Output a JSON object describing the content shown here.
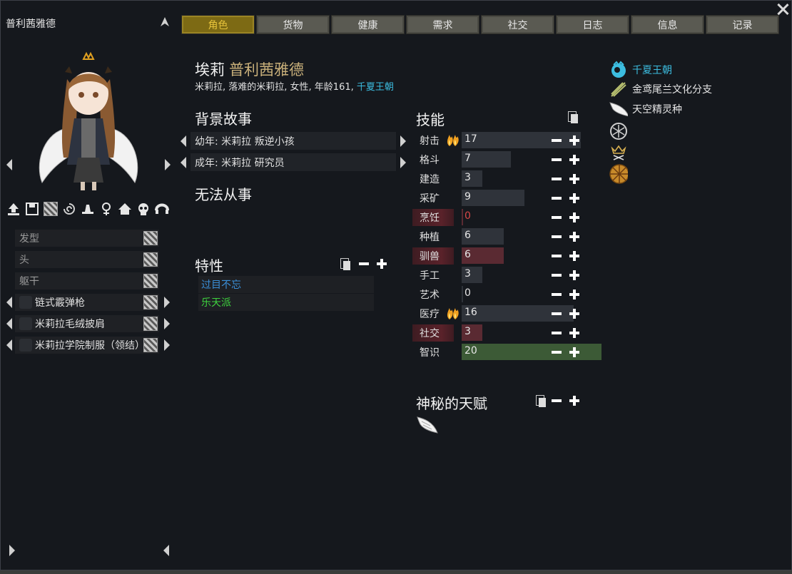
{
  "window": {
    "title": "普利茜雅德",
    "close_icon": "close-icon",
    "pin_icon": "pin-icon"
  },
  "tabs": [
    {
      "label": "角色",
      "active": true
    },
    {
      "label": "货物",
      "active": false
    },
    {
      "label": "健康",
      "active": false
    },
    {
      "label": "需求",
      "active": false
    },
    {
      "label": "社交",
      "active": false
    },
    {
      "label": "日志",
      "active": false
    },
    {
      "label": "信息",
      "active": false
    },
    {
      "label": "记录",
      "active": false
    }
  ],
  "character": {
    "first_name": "埃莉",
    "last_name": "普利茜雅德",
    "description": "米莉拉, 落难的米莉拉, 女性, 年龄161, ",
    "faction": "千夏王朝"
  },
  "toolbar_icons": [
    "export-icon",
    "save-icon",
    "pattern-icon",
    "swirl-icon",
    "hat-icon",
    "female-icon",
    "house-icon",
    "skull-icon",
    "headband-icon"
  ],
  "apparel": [
    {
      "label": "发型",
      "worn": false
    },
    {
      "label": "头",
      "worn": false
    },
    {
      "label": "躯干",
      "worn": false
    },
    {
      "label": "链式霰弹枪",
      "worn": true
    },
    {
      "label": "米莉拉毛绒披肩",
      "worn": true
    },
    {
      "label": "米莉拉学院制服（领结）",
      "worn": true
    }
  ],
  "backstory": {
    "heading": "背景故事",
    "childhood": "幼年: 米莉拉 叛逆小孩",
    "adulthood": "成年: 米莉拉 研究员"
  },
  "incapable": {
    "heading": "无法从事"
  },
  "traits": {
    "heading": "特性",
    "items": [
      {
        "label": "过目不忘",
        "color": "#3a8fd8"
      },
      {
        "label": "乐天派",
        "color": "#3ed23e"
      }
    ]
  },
  "skills": {
    "heading": "技能",
    "items": [
      {
        "name": "射击",
        "value": "17",
        "level": 17,
        "passion": "major",
        "disabled": false
      },
      {
        "name": "格斗",
        "value": "7",
        "level": 7,
        "passion": "none",
        "disabled": false
      },
      {
        "name": "建造",
        "value": "3",
        "level": 3,
        "passion": "none",
        "disabled": false
      },
      {
        "name": "采矿",
        "value": "9",
        "level": 9,
        "passion": "none",
        "disabled": false
      },
      {
        "name": "烹饪",
        "value": "0",
        "level": 0,
        "passion": "none",
        "disabled": true
      },
      {
        "name": "种植",
        "value": "6",
        "level": 6,
        "passion": "none",
        "disabled": false
      },
      {
        "name": "驯兽",
        "value": "6",
        "level": 6,
        "passion": "none",
        "disabled": true
      },
      {
        "name": "手工",
        "value": "3",
        "level": 3,
        "passion": "none",
        "disabled": false
      },
      {
        "name": "艺术",
        "value": "0",
        "level": 0,
        "passion": "none",
        "disabled": false
      },
      {
        "name": "医疗",
        "value": "16",
        "level": 16,
        "passion": "major",
        "disabled": false
      },
      {
        "name": "社交",
        "value": "3",
        "level": 3,
        "passion": "none",
        "disabled": true
      },
      {
        "name": "智识",
        "value": "20",
        "level": 20,
        "passion": "none",
        "disabled": false
      }
    ]
  },
  "mysterious_talent": {
    "heading": "神秘的天赋",
    "icon": "wing-icon"
  },
  "right_panel": [
    {
      "label": "千夏王朝",
      "icon": "faction-icon",
      "color": "#3cbde0"
    },
    {
      "label": "金鸢尾兰文化分支",
      "icon": "culture-icon",
      "color": "#e6e6e6"
    },
    {
      "label": "天空精灵种",
      "icon": "wing-icon",
      "color": "#e6e6e6"
    },
    {
      "label": "",
      "icon": "snowflake-icon",
      "color": "#e6e6e6"
    },
    {
      "label": "",
      "icon": "crown-icon",
      "color": "#e6e6e6"
    },
    {
      "label": "",
      "icon": "wheel-icon",
      "color": "#e6e6e6"
    }
  ],
  "colors": {
    "active_tab_bg": "#7d6a14",
    "active_tab_text": "#e6c23a",
    "last_name": "#c9b07a",
    "faction": "#3cbde0"
  }
}
